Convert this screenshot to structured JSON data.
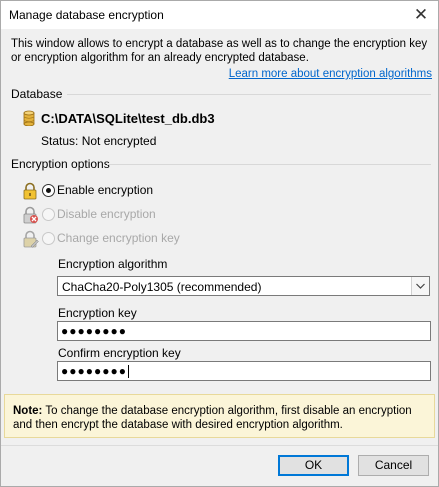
{
  "window": {
    "title": "Manage database encryption",
    "close_glyph": "✕"
  },
  "intro": {
    "text": "This window allows to encrypt a database as well as to change the encryption key or encryption algorithm for an already encrypted database.",
    "learn_more_link": "Learn more about encryption algorithms"
  },
  "database": {
    "section_title": "Database",
    "path": "C:\\DATA\\SQLite\\test_db.db3",
    "status": "Status: Not encrypted",
    "icon": "database-cylinder-icon"
  },
  "encryption_options": {
    "section_title": "Encryption options",
    "options": [
      {
        "label": "Enable encryption",
        "selected": true,
        "enabled": true,
        "icon": "lock-icon"
      },
      {
        "label": "Disable encryption",
        "selected": false,
        "enabled": false,
        "icon": "lock-remove-icon"
      },
      {
        "label": "Change encryption key",
        "selected": false,
        "enabled": false,
        "icon": "lock-edit-icon"
      }
    ],
    "algorithm_label": "Encryption algorithm",
    "algorithm_value": "ChaCha20-Poly1305 (recommended)",
    "key_label": "Encryption key",
    "key_value": "●●●●●●●●",
    "confirm_label": "Confirm encryption key",
    "confirm_value": "●●●●●●●●"
  },
  "note": {
    "prefix": "Note:",
    "text": " To change the database encryption algorithm, first disable an encryption and then encrypt the database with desired encryption algorithm."
  },
  "buttons": {
    "ok": "OK",
    "cancel": "Cancel"
  },
  "colors": {
    "link": "#0066cc",
    "note_background": "#fbf5d8",
    "primary_button_border": "#0078d7"
  }
}
